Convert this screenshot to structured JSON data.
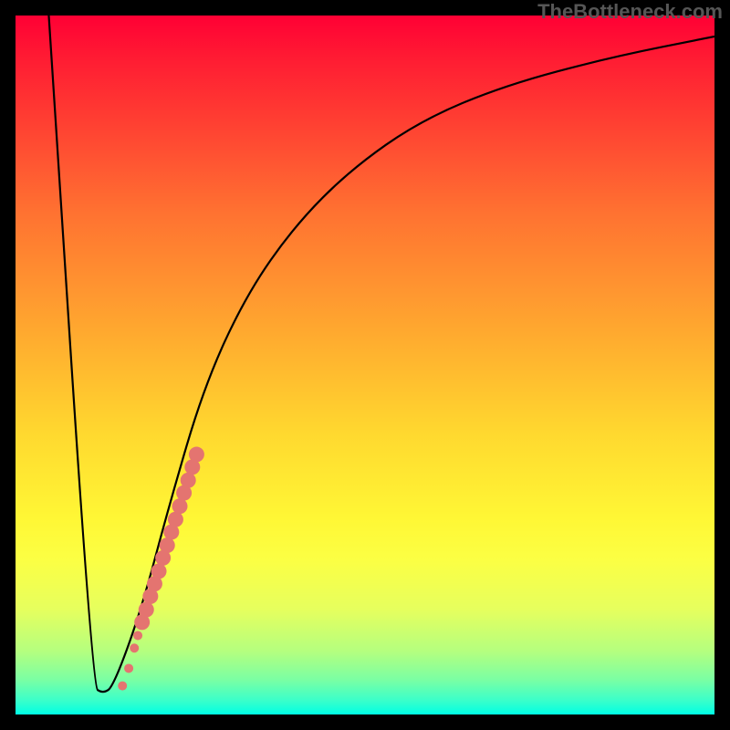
{
  "watermark": "TheBottleneck.com",
  "chart_data": {
    "type": "line",
    "title": "",
    "xlabel": "",
    "ylabel": "",
    "xlim": [
      0,
      100
    ],
    "ylim": [
      0,
      100
    ],
    "series": [
      {
        "name": "curve",
        "points": [
          [
            4.5,
            104
          ],
          [
            11,
            4
          ],
          [
            12.5,
            3
          ],
          [
            14,
            4
          ],
          [
            18,
            15
          ],
          [
            22,
            30
          ],
          [
            27,
            47
          ],
          [
            33,
            60
          ],
          [
            40,
            70
          ],
          [
            48,
            78
          ],
          [
            58,
            85
          ],
          [
            70,
            90
          ],
          [
            85,
            94
          ],
          [
            100,
            97
          ]
        ]
      }
    ],
    "markers": [
      {
        "x": 15.3,
        "y": 4.1,
        "r": 5
      },
      {
        "x": 16.2,
        "y": 6.6,
        "r": 5
      },
      {
        "x": 17.0,
        "y": 9.5,
        "r": 5
      },
      {
        "x": 17.5,
        "y": 11.3,
        "r": 5
      },
      {
        "x": 18.1,
        "y": 13.2,
        "r": 8.5
      },
      {
        "x": 18.7,
        "y": 15.0,
        "r": 8.5
      },
      {
        "x": 19.3,
        "y": 16.9,
        "r": 8.5
      },
      {
        "x": 19.9,
        "y": 18.7,
        "r": 8.5
      },
      {
        "x": 20.5,
        "y": 20.5,
        "r": 8.5
      },
      {
        "x": 21.1,
        "y": 22.4,
        "r": 8.5
      },
      {
        "x": 21.7,
        "y": 24.2,
        "r": 8.5
      },
      {
        "x": 22.3,
        "y": 26.1,
        "r": 8.5
      },
      {
        "x": 22.9,
        "y": 27.9,
        "r": 8.5
      },
      {
        "x": 23.5,
        "y": 29.8,
        "r": 8.5
      },
      {
        "x": 24.1,
        "y": 31.7,
        "r": 8.5
      },
      {
        "x": 24.7,
        "y": 33.5,
        "r": 8.5
      },
      {
        "x": 25.3,
        "y": 35.4,
        "r": 8.5
      },
      {
        "x": 25.9,
        "y": 37.2,
        "r": 8.5
      }
    ]
  }
}
